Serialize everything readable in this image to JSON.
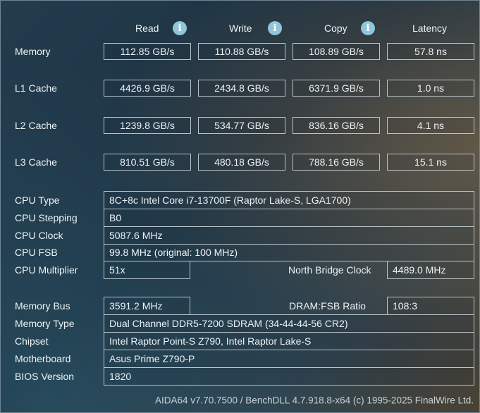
{
  "headers": {
    "read": "Read",
    "write": "Write",
    "copy": "Copy",
    "latency": "Latency"
  },
  "bench": [
    {
      "label": "Memory",
      "read": "112.85 GB/s",
      "write": "110.88 GB/s",
      "copy": "108.89 GB/s",
      "latency": "57.8 ns"
    },
    {
      "label": "L1 Cache",
      "read": "4426.9 GB/s",
      "write": "2434.8 GB/s",
      "copy": "6371.9 GB/s",
      "latency": "1.0 ns"
    },
    {
      "label": "L2 Cache",
      "read": "1239.8 GB/s",
      "write": "534.77 GB/s",
      "copy": "836.16 GB/s",
      "latency": "4.1 ns"
    },
    {
      "label": "L3 Cache",
      "read": "810.51 GB/s",
      "write": "480.18 GB/s",
      "copy": "788.16 GB/s",
      "latency": "15.1 ns"
    }
  ],
  "cpu": {
    "type_label": "CPU Type",
    "type_value": "8C+8c Intel Core i7-13700F  (Raptor Lake-S, LGA1700)",
    "stepping_label": "CPU Stepping",
    "stepping_value": "B0",
    "clock_label": "CPU Clock",
    "clock_value": "5087.6 MHz",
    "fsb_label": "CPU FSB",
    "fsb_value": "99.8 MHz  (original: 100 MHz)",
    "multiplier_label": "CPU Multiplier",
    "multiplier_value": "51x",
    "nb_clock_label": "North Bridge Clock",
    "nb_clock_value": "4489.0 MHz"
  },
  "memory": {
    "bus_label": "Memory Bus",
    "bus_value": "3591.2 MHz",
    "ratio_label": "DRAM:FSB Ratio",
    "ratio_value": "108:3",
    "type_label": "Memory Type",
    "type_value": "Dual Channel DDR5-7200 SDRAM  (34-44-44-56 CR2)",
    "chipset_label": "Chipset",
    "chipset_value": "Intel Raptor Point-S Z790, Intel Raptor Lake-S",
    "motherboard_label": "Motherboard",
    "motherboard_value": "Asus Prime Z790-P",
    "bios_label": "BIOS Version",
    "bios_value": "1820"
  },
  "footer": "AIDA64 v7.70.7500 / BenchDLL 4.7.918.8-x64  (c) 1995-2025 FinalWire Ltd."
}
